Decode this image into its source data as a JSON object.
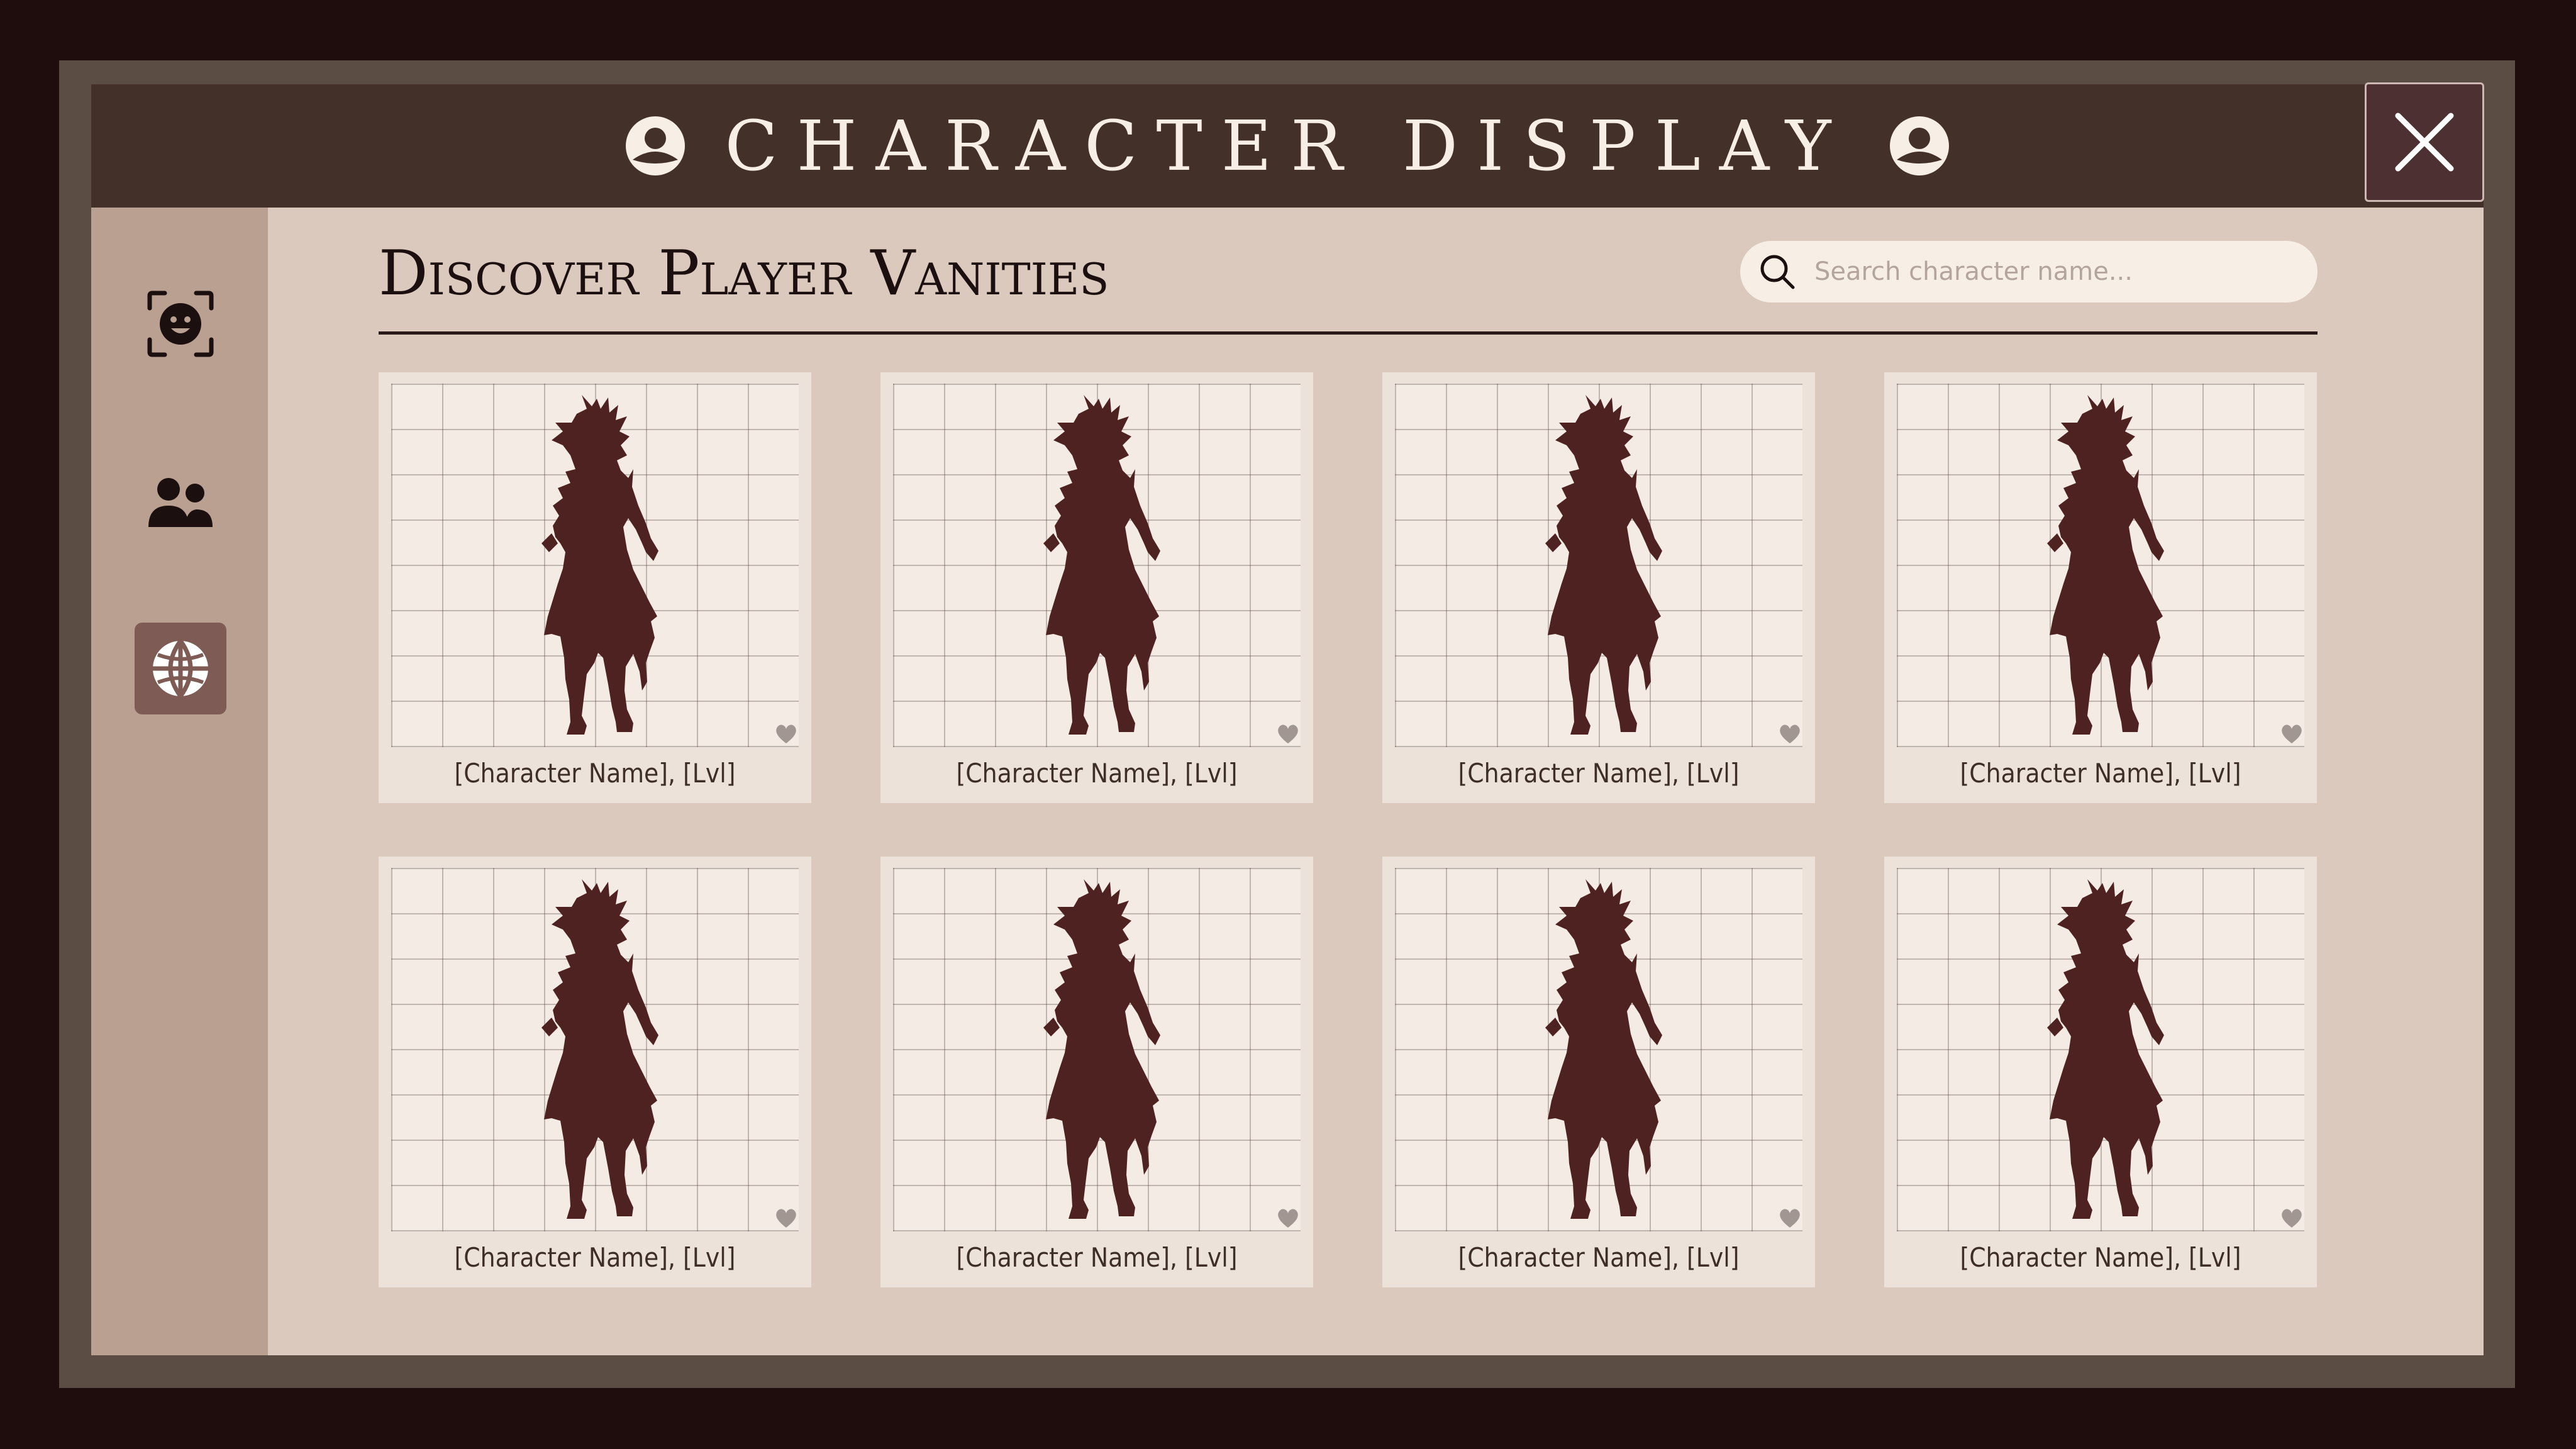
{
  "window": {
    "title": "CHARACTER DISPLAY",
    "close_label": "close"
  },
  "sidebar": {
    "items": [
      {
        "name": "face-scan",
        "active": false
      },
      {
        "name": "friends",
        "active": false
      },
      {
        "name": "global",
        "active": true
      }
    ]
  },
  "main": {
    "heading": "Discover Player Vanities",
    "search": {
      "placeholder": "Search character name..."
    },
    "cards": [
      {
        "caption": "[Character Name], [Lvl]"
      },
      {
        "caption": "[Character Name], [Lvl]"
      },
      {
        "caption": "[Character Name], [Lvl]"
      },
      {
        "caption": "[Character Name], [Lvl]"
      },
      {
        "caption": "[Character Name], [Lvl]"
      },
      {
        "caption": "[Character Name], [Lvl]"
      },
      {
        "caption": "[Character Name], [Lvl]"
      },
      {
        "caption": "[Character Name], [Lvl]"
      }
    ]
  },
  "colors": {
    "background": "#1f0c0c",
    "frame": "#5b4d44",
    "header": "#433129",
    "sidebar": "#b9a091",
    "main": "#dbc9be",
    "card": "#ece2d9",
    "silhouette": "#4f2222",
    "accent": "#7e5c55"
  },
  "icons": {
    "title_emblem": "emblem-icon",
    "close": "close-icon",
    "search": "search-icon",
    "favorite": "heart-icon"
  }
}
